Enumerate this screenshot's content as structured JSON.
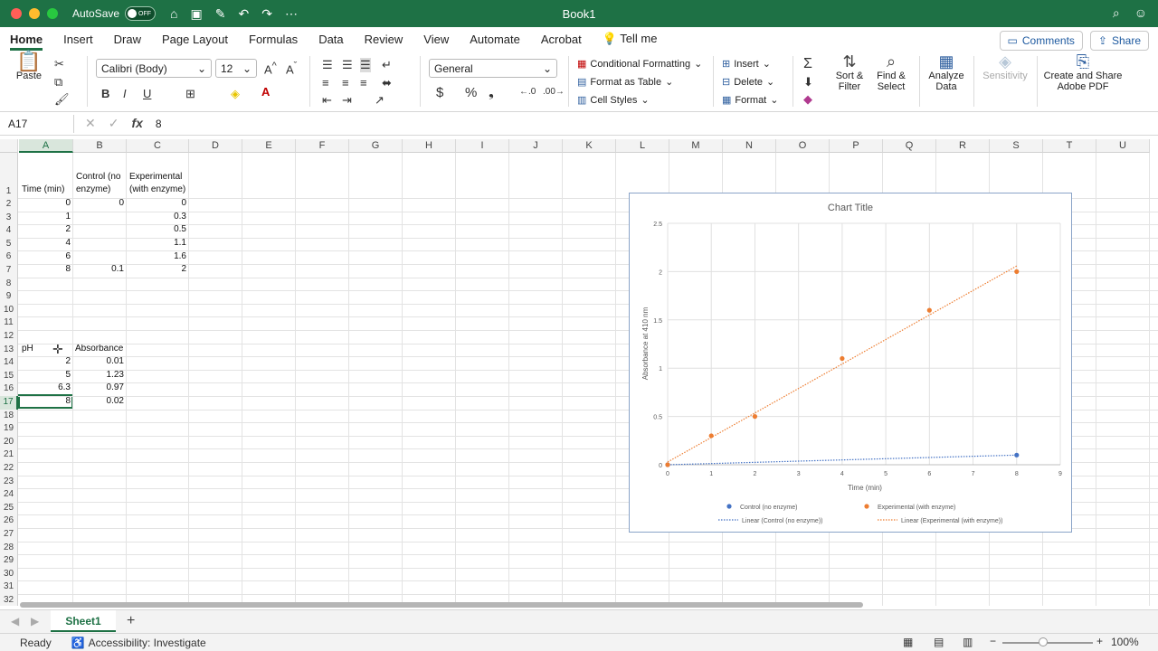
{
  "titlebar": {
    "autosave_label": "AutoSave",
    "autosave_state": "OFF",
    "doc_title": "Book1"
  },
  "tabs": [
    "Home",
    "Insert",
    "Draw",
    "Page Layout",
    "Formulas",
    "Data",
    "Review",
    "View",
    "Automate",
    "Acrobat"
  ],
  "tell_me": "Tell me",
  "comments_label": "Comments",
  "share_label": "Share",
  "ribbon": {
    "paste": "Paste",
    "font_name": "Calibri (Body)",
    "font_size": "12",
    "number_format": "General",
    "conditional_formatting": "Conditional Formatting",
    "format_as_table": "Format as Table",
    "cell_styles": "Cell Styles",
    "insert": "Insert",
    "delete": "Delete",
    "format": "Format",
    "sort_filter": [
      "Sort &",
      "Filter"
    ],
    "find_select": [
      "Find &",
      "Select"
    ],
    "analyze_data": [
      "Analyze",
      "Data"
    ],
    "sensitivity": "Sensitivity",
    "create_share": [
      "Create and Share",
      "Adobe PDF"
    ]
  },
  "formula_bar": {
    "name_box": "A17",
    "fx": "fx",
    "content": "8"
  },
  "columns": [
    "A",
    "B",
    "C",
    "D",
    "E",
    "F",
    "G",
    "H",
    "I",
    "J",
    "K",
    "L",
    "M",
    "N",
    "O",
    "P",
    "Q",
    "R",
    "S",
    "T",
    "U"
  ],
  "rows": [
    "1",
    "2",
    "3",
    "4",
    "5",
    "6",
    "7",
    "8",
    "9",
    "10",
    "11",
    "12",
    "13",
    "14",
    "15",
    "16",
    "17",
    "18",
    "19",
    "20",
    "21",
    "22",
    "23",
    "24",
    "25",
    "26",
    "27",
    "28",
    "29",
    "30",
    "31",
    "32"
  ],
  "table1": {
    "headers": [
      "Time (min)",
      "Control (no",
      "enzyme)",
      "Experimental",
      "(with enzyme)"
    ],
    "rows": [
      [
        "0",
        "0",
        "0"
      ],
      [
        "1",
        "",
        "0.3"
      ],
      [
        "2",
        "",
        "0.5"
      ],
      [
        "4",
        "",
        "1.1"
      ],
      [
        "6",
        "",
        "1.6"
      ],
      [
        "8",
        "0.1",
        "2"
      ]
    ]
  },
  "table2": {
    "headers": [
      "pH",
      "Absorbance"
    ],
    "rows": [
      [
        "2",
        "0.01"
      ],
      [
        "5",
        "1.23"
      ],
      [
        "6.3",
        "0.97"
      ],
      [
        "8",
        "0.02"
      ]
    ]
  },
  "chart_data": {
    "type": "scatter",
    "title": "Chart Title",
    "xlabel": "Time (min)",
    "ylabel": "Absorbance at 410 nm",
    "xlim": [
      0,
      9
    ],
    "ylim": [
      0,
      2.5
    ],
    "xticks": [
      "0",
      "1",
      "2",
      "3",
      "4",
      "5",
      "6",
      "7",
      "8",
      "9"
    ],
    "yticks": [
      "0",
      "0.5",
      "1",
      "1.5",
      "2",
      "2.5"
    ],
    "grid": true,
    "legend_position": "bottom",
    "series": [
      {
        "name": "Control (no enzyme)",
        "color": "#4472c4",
        "x": [
          0,
          8
        ],
        "y": [
          0,
          0.1
        ]
      },
      {
        "name": "Experimental (with enzyme)",
        "color": "#ed7d31",
        "x": [
          0,
          1,
          2,
          4,
          6,
          8
        ],
        "y": [
          0,
          0.3,
          0.5,
          1.1,
          1.6,
          2
        ]
      }
    ],
    "trendlines": [
      {
        "name": "Linear (Control (no enzyme))",
        "color": "#4472c4"
      },
      {
        "name": "Linear (Experimental (with enzyme))",
        "color": "#ed7d31"
      }
    ]
  },
  "sheet_tab": "Sheet1",
  "status": {
    "ready": "Ready",
    "accessibility": "Accessibility: Investigate",
    "zoom": "100%"
  }
}
